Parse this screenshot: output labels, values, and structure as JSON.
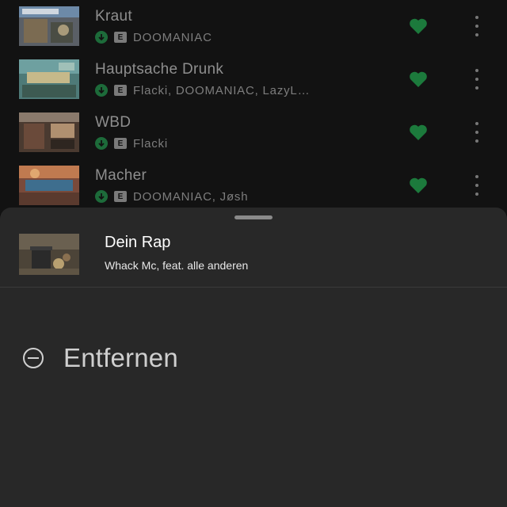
{
  "colors": {
    "accent_green": "#1DB954",
    "background": "#121212",
    "sheet_background": "#282828"
  },
  "tracks": [
    {
      "title": "Kraut",
      "artists": "DOOMANIAC",
      "downloaded": true,
      "explicit_label": "E",
      "liked": true,
      "icons": [
        "download-icon",
        "explicit-icon",
        "heart-icon",
        "more-icon"
      ]
    },
    {
      "title": "Hauptsache Drunk",
      "artists": "Flacki, DOOMANIAC, LazyL…",
      "downloaded": true,
      "explicit_label": "E",
      "liked": true,
      "icons": [
        "download-icon",
        "explicit-icon",
        "heart-icon",
        "more-icon"
      ]
    },
    {
      "title": "WBD",
      "artists": "Flacki",
      "downloaded": true,
      "explicit_label": "E",
      "liked": true,
      "icons": [
        "download-icon",
        "explicit-icon",
        "heart-icon",
        "more-icon"
      ]
    },
    {
      "title": "Macher",
      "artists": "DOOMANIAC, Jøsh",
      "downloaded": true,
      "explicit_label": "E",
      "liked": true,
      "icons": [
        "download-icon",
        "explicit-icon",
        "heart-icon",
        "more-icon"
      ]
    }
  ],
  "sheet": {
    "track_title": "Dein Rap",
    "track_subtitle": "Whack Mc, feat. alle anderen",
    "actions": [
      {
        "label": "Entfernen",
        "icon": "minus-circle-icon"
      }
    ]
  }
}
